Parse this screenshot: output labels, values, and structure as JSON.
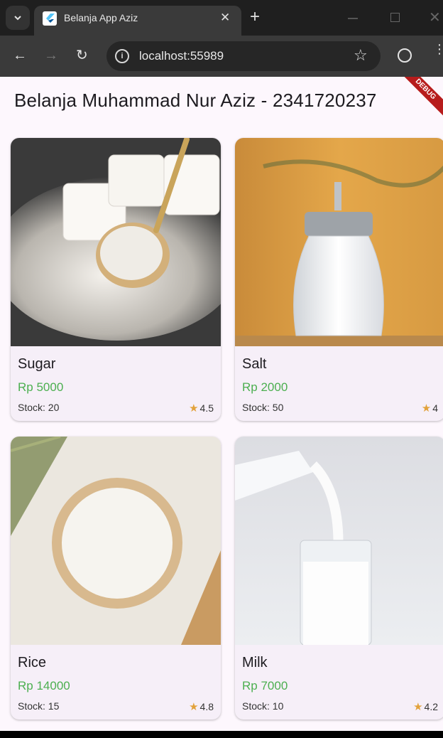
{
  "browser": {
    "tab_title": "Belanja App Aziz",
    "url": "localhost:55989"
  },
  "app": {
    "title": "Belanja Muhammad Nur Aziz - 2341720237",
    "debug_label": "DEBUG",
    "price_color": "#4caf50",
    "star_color": "#e2a23b",
    "products": [
      {
        "name": "Sugar",
        "price": "Rp 5000",
        "stock": "Stock: 20",
        "rating": "4.5",
        "image": "sugar-cubes-spoon"
      },
      {
        "name": "Salt",
        "price": "Rp 2000",
        "stock": "Stock: 50",
        "rating": "4",
        "image": "salt-shaker"
      },
      {
        "name": "Rice",
        "price": "Rp 14000",
        "stock": "Stock: 15",
        "rating": "4.8",
        "image": "rice-bowl"
      },
      {
        "name": "Milk",
        "price": "Rp 7000",
        "stock": "Stock: 10",
        "rating": "4.2",
        "image": "milk-glass"
      }
    ]
  }
}
